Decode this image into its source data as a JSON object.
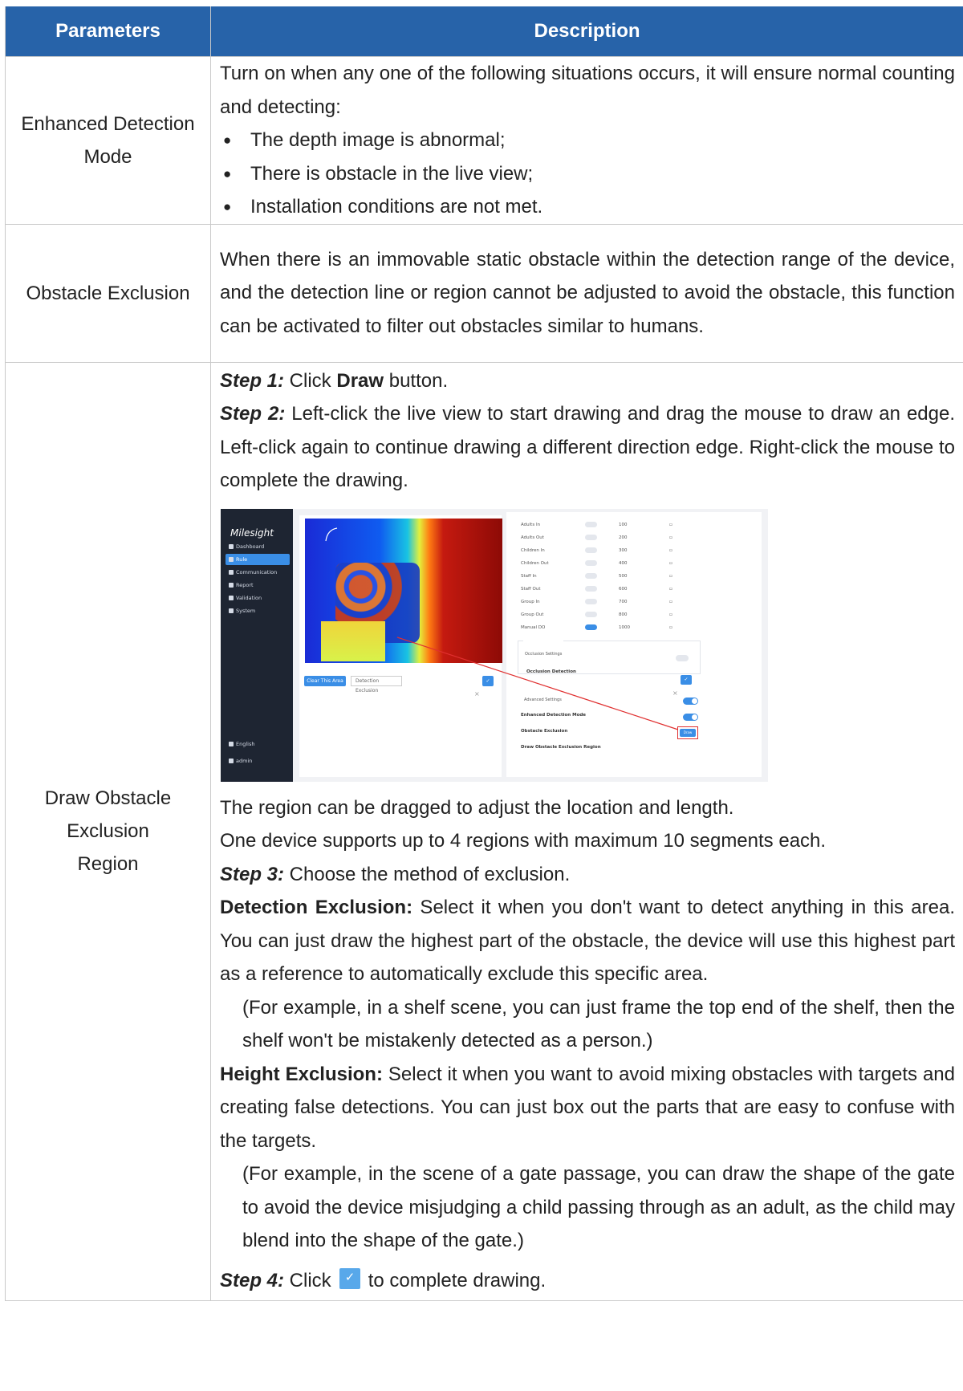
{
  "header": {
    "col1": "Parameters",
    "col2": "Description"
  },
  "rows": {
    "enhanced": {
      "param": "Enhanced Detection Mode",
      "intro": "Turn on when any one of the following situations occurs, it will ensure normal counting and detecting:",
      "bullets": [
        "The depth image is abnormal;",
        "There is obstacle in the live view;",
        "Installation conditions are not met."
      ]
    },
    "obstacle": {
      "param": "Obstacle Exclusion",
      "text": "When there is an immovable static obstacle within the detection range of the device, and the detection line or region cannot be adjusted to avoid the obstacle, this function can be activated to filter out obstacles similar to humans."
    },
    "draw": {
      "param": "Draw Obstacle Exclusion Region",
      "step1_label": "Step 1:",
      "step1_pre": " Click ",
      "step1_bold": "Draw",
      "step1_post": " button.",
      "step2_label": "Step 2:",
      "step2_text": " Left-click the live view to start drawing and drag the mouse to draw an edge. Left-click again to continue drawing a different direction edge. Right-click the mouse to complete the drawing.",
      "drag_text": "The region can be dragged to adjust the location and length.",
      "support_text": "One device supports up to 4 regions with maximum 10 segments each.",
      "step3_label": "Step 3:",
      "step3_text": " Choose the method of exclusion.",
      "det_label": "Detection Exclusion:",
      "det_text": " Select it when you don't want to detect anything in this area. You can just draw the highest part of the obstacle, the device will use this highest part as a reference to automatically exclude this specific area.",
      "det_example": "(For example, in a shelf scene, you can just frame the top end of the shelf, then the shelf won't be mistakenly detected as a person.)",
      "height_label": "Height Exclusion:",
      "height_text": " Select it when you want to avoid mixing obstacles with targets and creating false detections. You can just box out the parts that are easy to confuse with the targets.",
      "height_example": "(For example, in the scene of a gate passage, you can draw the shape of the gate to avoid the device misjudging a child passing through as an adult, as the child may blend into the shape of the gate.)",
      "step4_label": "Step 4:",
      "step4_pre": " Click",
      "step4_post": "to complete drawing."
    }
  },
  "screenshot": {
    "logo": "Milesight",
    "nav": [
      "Dashboard",
      "Rule",
      "Communication",
      "Report",
      "Validation",
      "System"
    ],
    "nav_active": "Rule",
    "lang": "English",
    "user": "admin",
    "clear_button": "Clear This Area",
    "exclusion_select": "Detection Exclusion",
    "triggers": [
      {
        "name": "Adults In",
        "value": "100"
      },
      {
        "name": "Adults Out",
        "value": "200"
      },
      {
        "name": "Children In",
        "value": "300"
      },
      {
        "name": "Children Out",
        "value": "400"
      },
      {
        "name": "Staff In",
        "value": "500"
      },
      {
        "name": "Staff Out",
        "value": "600"
      },
      {
        "name": "Group In",
        "value": "700"
      },
      {
        "name": "Group Out",
        "value": "800"
      },
      {
        "name": "Manual DO",
        "value": "1000"
      }
    ],
    "occlusion_settings": "Occlusion Settings",
    "occlusion_detection": "Occlusion Detection",
    "advanced_settings": "Advanced Settings",
    "enhanced_mode": "Enhanced Detection Mode",
    "obstacle_exclusion": "Obstacle Exclusion",
    "draw_region": "Draw Obstacle Exclusion Region",
    "draw_button": "Draw"
  }
}
